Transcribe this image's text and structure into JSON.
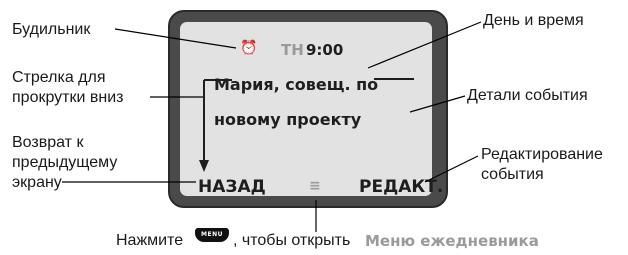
{
  "callouts": {
    "alarm": "Будильник",
    "scroll_arrow_line1": "Стрелка для",
    "scroll_arrow_line2": "прокрутки вниз",
    "back_line1": "Возврат к",
    "back_line2": "предыдущему",
    "back_line3": "экрану",
    "day_time": "День и время",
    "event_details": "Детали события",
    "edit_line1": "Редактирование",
    "edit_line2": "события"
  },
  "screen": {
    "alarm_glyph": "⏰",
    "day": "ТН",
    "time": "9:00",
    "detail_line1": "Мария, совещ. по",
    "detail_line2": "новому проекту",
    "left_softkey": "НАЗАД",
    "menu_glyph": "≡",
    "right_softkey": "РЕДАКТ."
  },
  "instruction": {
    "prefix": "Нажмите",
    "key_label": "MENU",
    "middle": ", чтобы открыть",
    "menu_name": "Меню ежедневника"
  },
  "colors": {
    "frame": "#4a4a4a",
    "screen": "#e2e2e2",
    "menu_name": "#9a9a9a"
  },
  "icons": [
    "alarm-clock-icon",
    "scroll-down-arrow-icon",
    "menu-lines-icon",
    "menu-key-icon"
  ]
}
